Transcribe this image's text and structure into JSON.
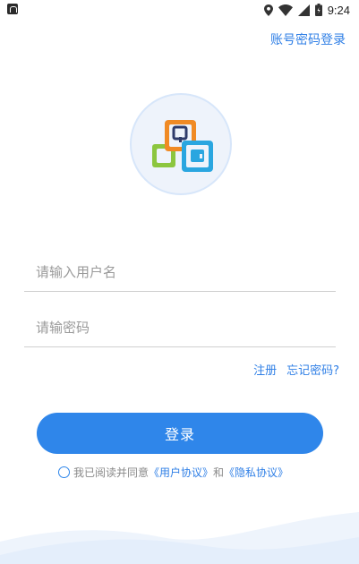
{
  "status_bar": {
    "time": "9:24",
    "icons": [
      "notification-icon",
      "location-icon",
      "wifi-icon",
      "signal-icon",
      "battery-icon"
    ]
  },
  "header": {
    "account_login_label": "账号密码登录"
  },
  "form": {
    "username_placeholder": "请输入用户名",
    "password_placeholder": "请输密码",
    "register_label": "注册",
    "forgot_label": "忘记密码?",
    "login_label": "登录"
  },
  "agreement": {
    "prefix": "我已阅读并同意",
    "user_agreement": "《用户协议》",
    "conjunction": "和",
    "privacy_agreement": "《隐私协议》",
    "checked": false
  },
  "colors": {
    "accent": "#2f86ea",
    "link": "#2f7fe6"
  }
}
